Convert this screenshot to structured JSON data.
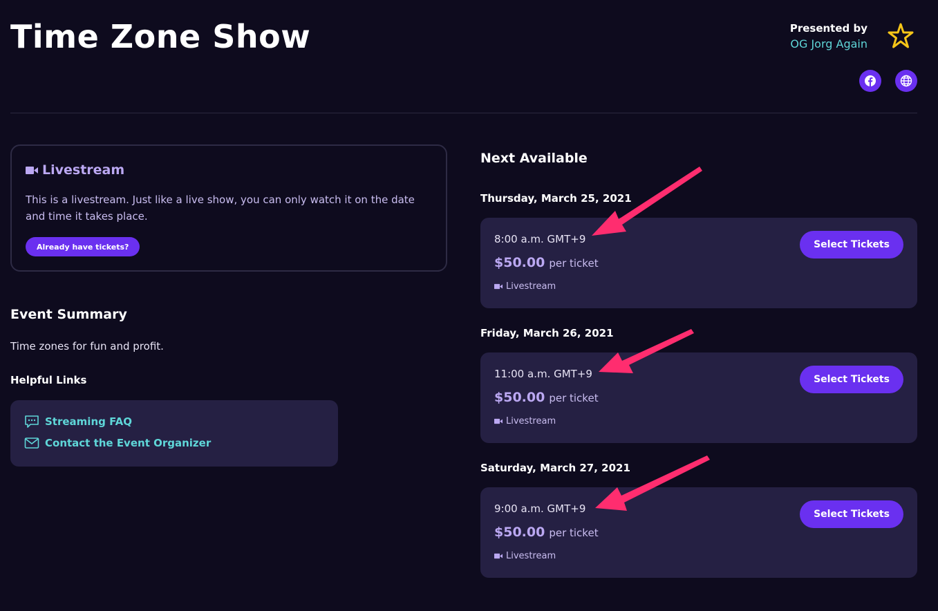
{
  "header": {
    "title": "Time Zone Show",
    "presented_by_label": "Presented by",
    "presenter_name": "OG Jorg Again",
    "logo_icon": "star-logo-icon",
    "social_icons": [
      "facebook-icon",
      "globe-icon"
    ]
  },
  "livestream": {
    "heading": "Livestream",
    "description": "This is a livestream. Just like a live show, you can only watch it on the date and time it takes place.",
    "button_label": "Already have tickets?"
  },
  "summary": {
    "heading": "Event Summary",
    "text": "Time zones for fun and profit.",
    "helpful_links_heading": "Helpful Links",
    "links": [
      {
        "label": "Streaming FAQ",
        "icon": "chat-bubble-icon"
      },
      {
        "label": "Contact the Event Organizer",
        "icon": "envelope-icon"
      }
    ]
  },
  "availability": {
    "heading": "Next Available",
    "showings": [
      {
        "date": "Thursday, March 25, 2021",
        "time": "8:00 a.m. GMT+9",
        "price": "$50.00",
        "per": "per ticket",
        "type": "Livestream",
        "button": "Select Tickets"
      },
      {
        "date": "Friday, March 26, 2021",
        "time": "11:00 a.m. GMT+9",
        "price": "$50.00",
        "per": "per ticket",
        "type": "Livestream",
        "button": "Select Tickets"
      },
      {
        "date": "Saturday, March 27, 2021",
        "time": "9:00 a.m. GMT+9",
        "price": "$50.00",
        "per": "per ticket",
        "type": "Livestream",
        "button": "Select Tickets"
      }
    ]
  },
  "colors": {
    "background": "#0e0b1e",
    "card": "#252043",
    "accent_purple": "#6a30f0",
    "teal_link": "#5fd6d8",
    "lavender_text": "#bba8f2",
    "logo_yellow": "#f5c518",
    "annotation_arrow": "#ff2d6f"
  }
}
